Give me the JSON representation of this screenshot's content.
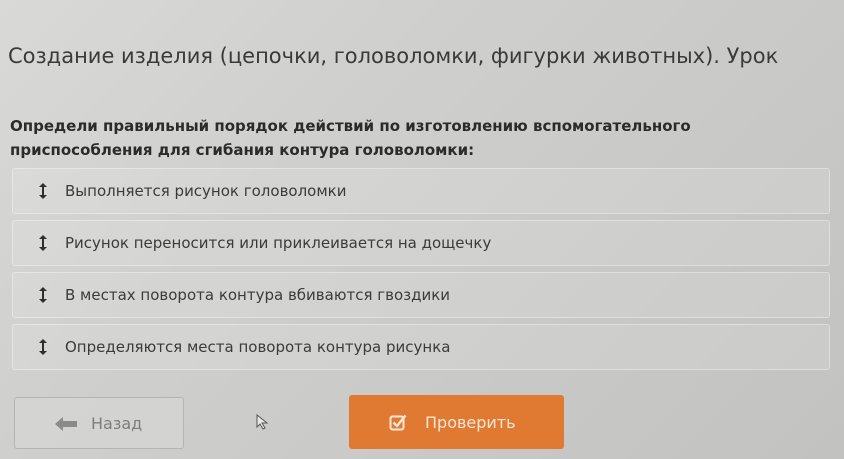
{
  "lesson": {
    "title": "Создание изделия (цепочки, головоломки, фигурки животных). Урок"
  },
  "question": {
    "text": "Определи правильный порядок действий по изготовлению вспомогательного приспособления для сгибания контура головоломки:"
  },
  "items": [
    {
      "label": "Выполняется рисунок головоломки",
      "icon": "drag-handle-icon"
    },
    {
      "label": "Рисунок переносится или приклеивается на дощечку",
      "icon": "drag-handle-icon"
    },
    {
      "label": "В местах поворота контура вбиваются гвоздики",
      "icon": "drag-handle-icon"
    },
    {
      "label": "Определяются места поворота контура рисунка",
      "icon": "drag-handle-icon"
    }
  ],
  "buttons": {
    "back_label": "Назад",
    "back_icon": "arrow-left-icon",
    "check_label": "Проверить",
    "check_icon": "checkbox-icon"
  },
  "colors": {
    "accent": "#e07a33",
    "text": "#2e2e2e",
    "muted": "#7d7d7d"
  }
}
